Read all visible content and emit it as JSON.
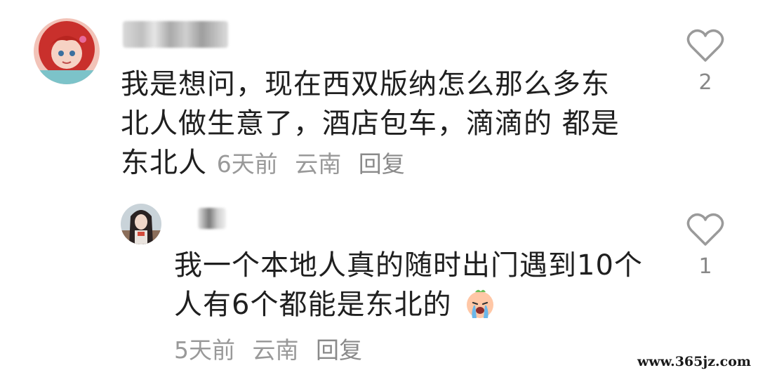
{
  "comments": [
    {
      "text_lines": [
        "我是想问，现在西双版纳怎么那么多东",
        "北人做生意了，酒店包车，滴滴的 都是",
        "东北人"
      ],
      "time": "6天前",
      "location": "云南",
      "reply_label": "回复",
      "likes": "2"
    },
    {
      "text_lines": [
        "我一个本地人真的随时出门遇到10个",
        "人有6个都能是东北的"
      ],
      "time": "5天前",
      "location": "云南",
      "reply_label": "回复",
      "likes": "1",
      "emoji": "crying-face"
    }
  ],
  "watermark": "www.365jz.com"
}
